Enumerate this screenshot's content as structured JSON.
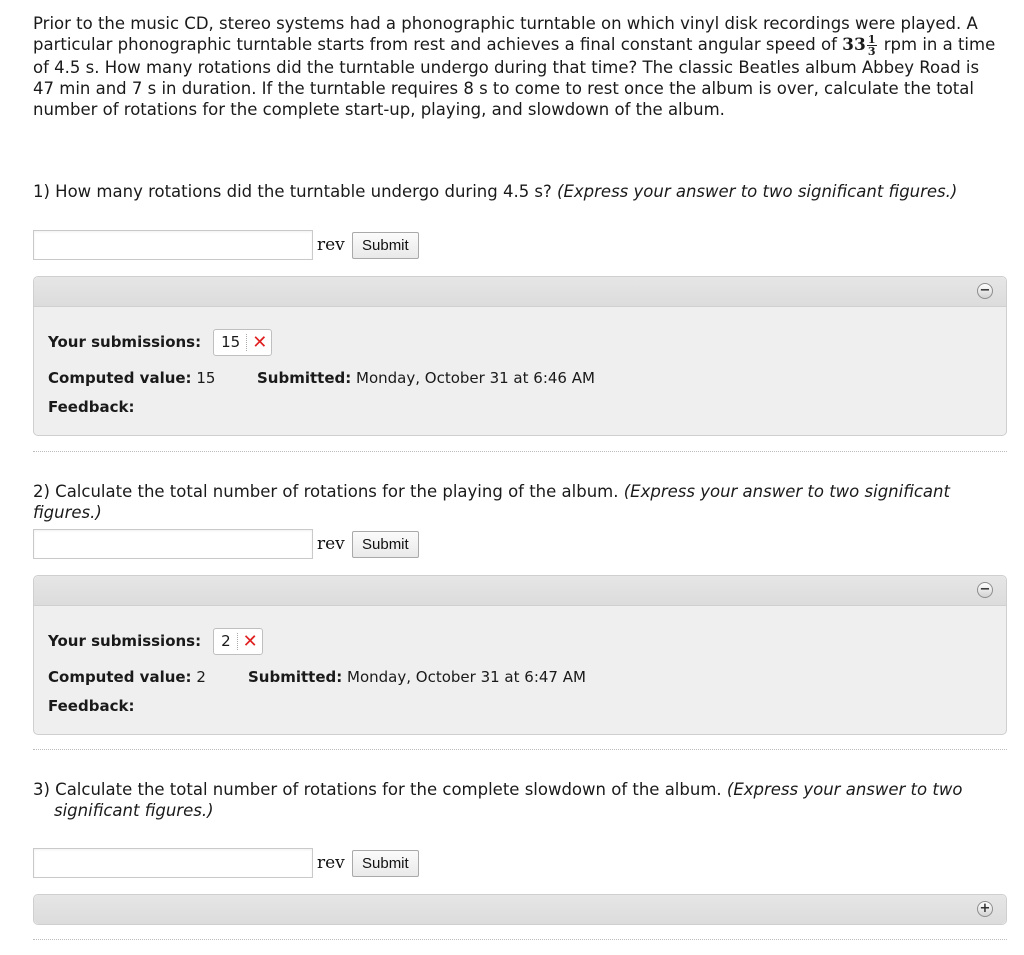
{
  "problem": {
    "text_before": "Prior to the music CD, stereo systems had a phonographic turntable on which vinyl disk recordings were played. A particular phonographic turntable starts from rest and achieves a final constant angular speed of ",
    "speed_whole": "33",
    "speed_num": "1",
    "speed_den": "3",
    "text_after": " rpm in a time of 4.5 s. How many rotations did the turntable undergo during that time? The classic Beatles album Abbey Road is 47 min and 7 s in duration. If the turntable requires 8 s to come to rest once the album is over, calculate the total number of rotations for the complete start-up, playing, and slowdown of the album."
  },
  "questions": [
    {
      "text": "1) How many rotations did the turntable undergo during 4.5 s? ",
      "hint": "(Express your answer to two significant figures.)",
      "unit": "rev",
      "submit_label": "Submit",
      "input_value": "",
      "panel_state": "expanded",
      "toggle_icon": "minus-circle-icon",
      "submissions_label": "Your submissions:",
      "submission_value": "15",
      "computed_label": "Computed value:",
      "computed_value": "15",
      "submitted_label": "Submitted:",
      "submitted_time": "Monday, October 31 at 6:46 AM",
      "feedback_label": "Feedback:"
    },
    {
      "text": "2) Calculate the total number of rotations for the playing of the album. ",
      "hint": "(Express your answer to two significant figures.)",
      "unit": "rev",
      "submit_label": "Submit",
      "input_value": "",
      "panel_state": "expanded",
      "toggle_icon": "minus-circle-icon",
      "submissions_label": "Your submissions:",
      "submission_value": "2",
      "computed_label": "Computed value:",
      "computed_value": "2",
      "submitted_label": "Submitted:",
      "submitted_time": "Monday, October 31 at 6:47 AM",
      "feedback_label": "Feedback:"
    },
    {
      "text": "3) Calculate the total number of rotations for the complete slowdown of the album. ",
      "hint_line1": "(Express your answer to two",
      "hint_line2": "significant figures.)",
      "unit": "rev",
      "submit_label": "Submit",
      "input_value": "",
      "panel_state": "collapsed",
      "toggle_icon": "plus-circle-icon"
    }
  ],
  "colors": {
    "incorrect": "#e02020",
    "panel_bg": "#efefef",
    "panel_header": "#dcdcdc"
  }
}
